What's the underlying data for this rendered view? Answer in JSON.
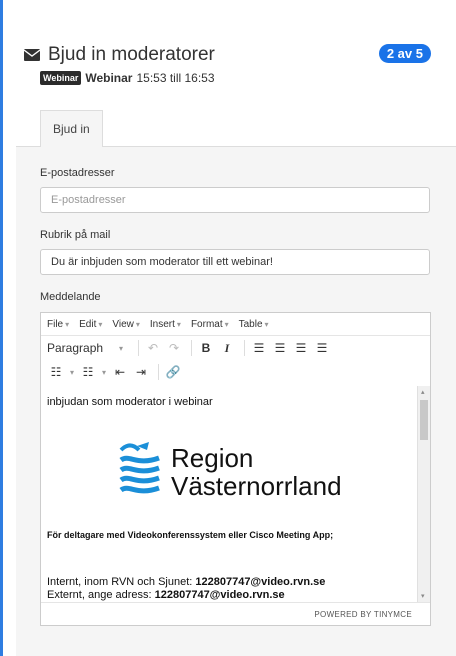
{
  "header": {
    "title": "Bjud in moderatorer",
    "badge": "2 av 5",
    "tag": "Webinar",
    "event_name": "Webinar",
    "time_range": "15:53 till 16:53"
  },
  "tabs": [
    {
      "label": "Bjud in"
    }
  ],
  "form": {
    "emails_label": "E-postadresser",
    "emails_placeholder": "E-postadresser",
    "subject_label": "Rubrik på mail",
    "subject_value": "Du är inbjuden som moderator till ett webinar!",
    "message_label": "Meddelande"
  },
  "editor": {
    "menu": [
      "File",
      "Edit",
      "View",
      "Insert",
      "Format",
      "Table"
    ],
    "block_format": "Paragraph",
    "content": {
      "intro": "inbjudan som moderator i webinar",
      "logo_line1": "Region",
      "logo_line2": "Västernorrland",
      "participants_heading": "För deltagare med Videokonferenssystem eller Cisco Meeting App;",
      "internal_prefix": "Internt, inom RVN och Sjunet: ",
      "internal_address": "122807747@video.rvn.se",
      "external_prefix": "Externt, ange adress: ",
      "external_address": "122807747@video.rvn.se"
    },
    "powered_by": "POWERED BY TINYMCE"
  },
  "colors": {
    "accent": "#1a73e8",
    "left_bar": "#2f7de1",
    "logo_blue": "#1b8fd8"
  }
}
